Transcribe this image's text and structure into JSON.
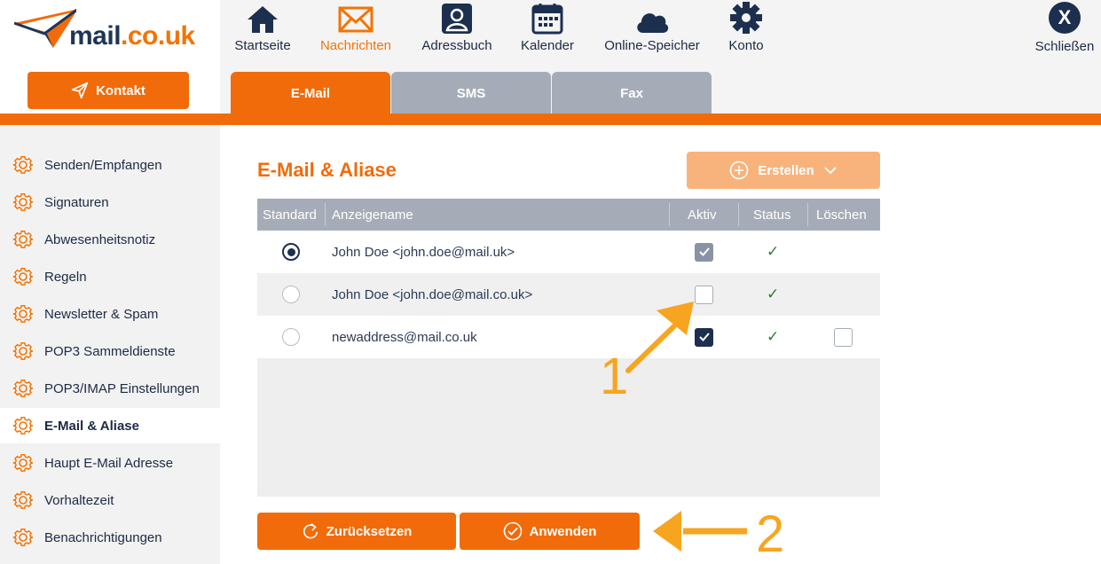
{
  "brand": {
    "name_part1": "mail",
    "name_part2": ".co.uk"
  },
  "header": {
    "contact_label": "Kontakt",
    "nav": [
      {
        "label": "Startseite",
        "icon": "home-icon"
      },
      {
        "label": "Nachrichten",
        "icon": "envelope-icon",
        "active": true
      },
      {
        "label": "Adressbuch",
        "icon": "contact-card-icon"
      },
      {
        "label": "Kalender",
        "icon": "calendar-icon"
      },
      {
        "label": "Online-Speicher",
        "icon": "cloud-icon"
      },
      {
        "label": "Konto",
        "icon": "gear-icon"
      }
    ],
    "close": {
      "symbol": "X",
      "label": "Schließen"
    },
    "tabs": [
      {
        "label": "E-Mail",
        "active": true
      },
      {
        "label": "SMS"
      },
      {
        "label": "Fax"
      }
    ]
  },
  "sidebar": {
    "items": [
      {
        "label": "Senden/Empfangen"
      },
      {
        "label": "Signaturen"
      },
      {
        "label": "Abwesenheitsnotiz"
      },
      {
        "label": "Regeln"
      },
      {
        "label": "Newsletter & Spam"
      },
      {
        "label": "POP3 Sammeldienste"
      },
      {
        "label": "POP3/IMAP Einstellungen"
      },
      {
        "label": "E-Mail & Aliase",
        "active": true
      },
      {
        "label": "Haupt E-Mail Adresse"
      },
      {
        "label": "Vorhaltezeit"
      },
      {
        "label": "Benachrichtigungen"
      }
    ]
  },
  "main": {
    "title": "E-Mail & Aliase",
    "create_label": "Erstellen",
    "table": {
      "headers": {
        "standard": "Standard",
        "name": "Anzeigename",
        "active": "Aktiv",
        "status": "Status",
        "delete": "Löschen"
      },
      "rows": [
        {
          "name": "John Doe <john.doe@mail.uk>",
          "standard": true,
          "active": "checked-grey",
          "status": "✓",
          "deletable": false
        },
        {
          "name": "John Doe <john.doe@mail.co.uk>",
          "standard": false,
          "active": "unchecked",
          "status": "✓",
          "deletable": false
        },
        {
          "name": "newaddress@mail.co.uk",
          "standard": false,
          "active": "checked",
          "status": "✓",
          "deletable": true
        }
      ]
    },
    "reset_label": "Zurücksetzen",
    "apply_label": "Anwenden"
  },
  "annotations": {
    "label1": "1",
    "label2": "2",
    "color": "#f7a520"
  },
  "colors": {
    "accent": "#f26b0a",
    "navy": "#1d2f4f",
    "tab_inactive": "#a6acb7"
  }
}
